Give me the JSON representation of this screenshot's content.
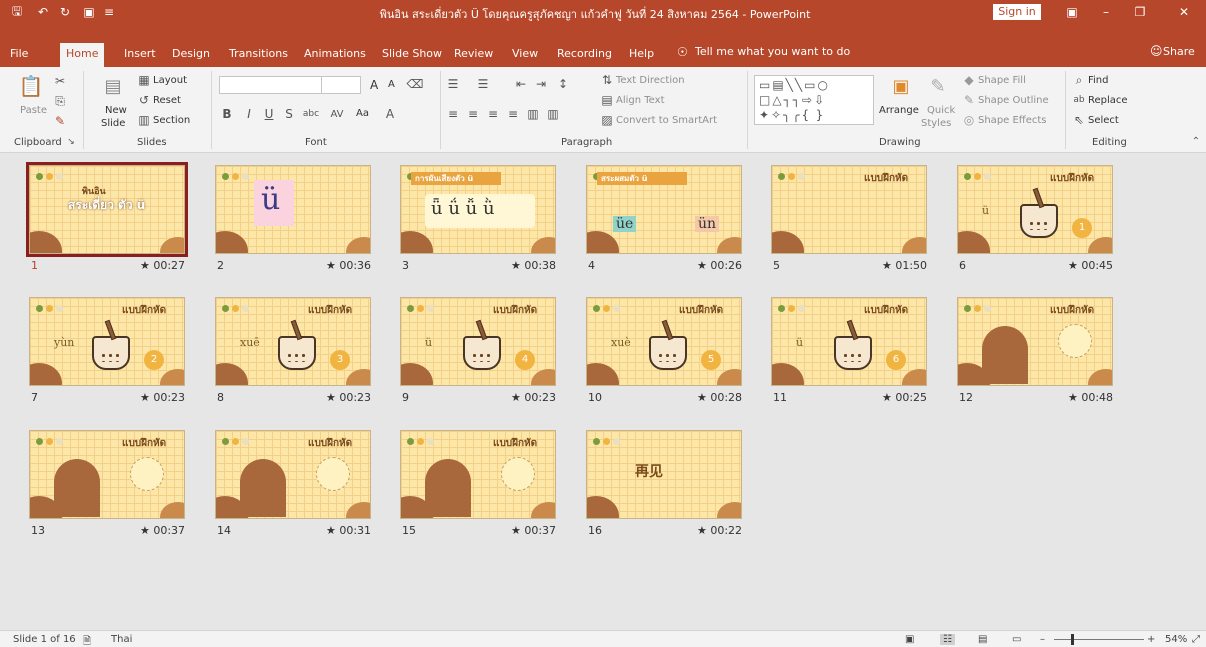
{
  "window": {
    "title": "พินอิน สระเดี่ยวตัว Ü โดยคุณครูสุภัคชญา แก้วคำฟู วันที่ 24 สิงหาคม 2564  -  PowerPoint",
    "sign_in": "Sign in",
    "qat_icons": [
      "save-icon",
      "undo-icon",
      "redo-icon",
      "slideshow-icon",
      "customize-icon"
    ]
  },
  "tabs": [
    "File",
    "Home",
    "Insert",
    "Design",
    "Transitions",
    "Animations",
    "Slide Show",
    "Review",
    "View",
    "Recording",
    "Help"
  ],
  "active_tab": "Home",
  "tell_me": "Tell me what you want to do",
  "share": "Share",
  "ribbon": {
    "clipboard": {
      "label": "Clipboard",
      "paste": "Paste"
    },
    "slides": {
      "label": "Slides",
      "new_slide": "New",
      "new_slide2": "Slide",
      "layout": "Layout",
      "reset": "Reset",
      "section": "Section"
    },
    "font": {
      "label": "Font",
      "grow": "A",
      "shrink": "A",
      "case": "Aa"
    },
    "paragraph": {
      "label": "Paragraph",
      "text_direction": "Text Direction",
      "align_text": "Align Text",
      "smartart": "Convert to SmartArt"
    },
    "drawing": {
      "label": "Drawing",
      "arrange": "Arrange",
      "quick_styles": "Quick",
      "quick_styles2": "Styles",
      "shape_fill": "Shape Fill",
      "shape_outline": "Shape Outline",
      "shape_effects": "Shape Effects"
    },
    "editing": {
      "label": "Editing",
      "find": "Find",
      "replace": "Replace",
      "select": "Select"
    }
  },
  "slides": [
    {
      "num": "1",
      "time": "00:27",
      "title": "พินอิน",
      "subtitle": "สระเดี่ยว ตัว ü",
      "selected": true
    },
    {
      "num": "2",
      "time": "00:36",
      "big": "ü"
    },
    {
      "num": "3",
      "time": "00:38",
      "tones": "ǖ ǘ ǚ ǜ",
      "band": "การผันเสียงตัว ü"
    },
    {
      "num": "4",
      "time": "00:26",
      "band": "สระผสมตัว ü",
      "left": "üe",
      "right": "ün"
    },
    {
      "num": "5",
      "time": "01:50",
      "title": "แบบฝึกหัด"
    },
    {
      "num": "6",
      "time": "00:45",
      "title": "แบบฝึกหัด",
      "word": "ü",
      "n": "1"
    },
    {
      "num": "7",
      "time": "00:23",
      "title": "แบบฝึกหัด",
      "word": "yùn",
      "n": "2"
    },
    {
      "num": "8",
      "time": "00:23",
      "title": "แบบฝึกหัด",
      "word": "xuē",
      "n": "3"
    },
    {
      "num": "9",
      "time": "00:23",
      "title": "แบบฝึกหัด",
      "word": "ü",
      "n": "4"
    },
    {
      "num": "10",
      "time": "00:28",
      "title": "แบบฝึกหัด",
      "word": "xuè",
      "n": "5"
    },
    {
      "num": "11",
      "time": "00:25",
      "title": "แบบฝึกหัด",
      "word": "ü",
      "n": "6"
    },
    {
      "num": "12",
      "time": "00:48",
      "title": "แบบฝึกหัด"
    },
    {
      "num": "13",
      "time": "00:37",
      "title": "แบบฝึกหัด"
    },
    {
      "num": "14",
      "time": "00:31",
      "title": "แบบฝึกหัด"
    },
    {
      "num": "15",
      "time": "00:37",
      "title": "แบบฝึกหัด"
    },
    {
      "num": "16",
      "time": "00:22",
      "title": "再见"
    }
  ],
  "status": {
    "slide_info": "Slide 1 of 16",
    "language": "Thai",
    "zoom": "54%"
  },
  "colors": {
    "accent": "#b7472a",
    "slide_bg": "#fde7a8",
    "selected_outline": "#8b1f1f"
  }
}
